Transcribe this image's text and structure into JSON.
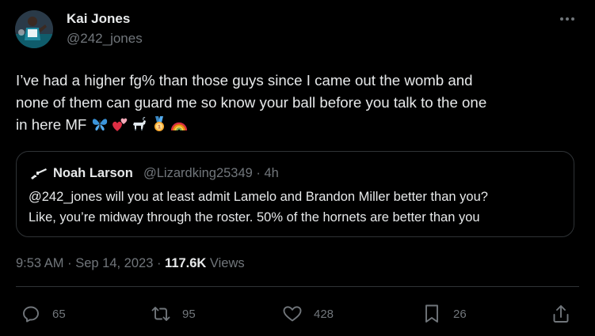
{
  "tweet": {
    "author": {
      "name": "Kai Jones",
      "handle": "@242_jones"
    },
    "text_lines": [
      "I’ve had a higher fg% than those guys since I came out the womb and",
      "none of them can guard me so know your ball before you talk to the one",
      "in here MF"
    ],
    "emojis": [
      "butterfly-icon",
      "two-hearts-icon",
      "goat-icon",
      "medal-icon",
      "rainbow-icon"
    ],
    "quoted": {
      "author_name": "Noah Larson",
      "meta": "@Lizardking25349 · 4h",
      "text_lines": [
        "@242_jones will you at least admit Lamelo and Brandon Miller better than you?",
        "Like, you’re midway through the roster. 50% of the hornets are better than you"
      ]
    },
    "timestamp": "9:53 AM · Sep 14, 2023 · ",
    "views_count": "117.6K",
    "views_label": " Views",
    "actions": {
      "replies": "65",
      "retweets": "95",
      "likes": "428",
      "bookmarks": "26"
    }
  },
  "colors": {
    "background": "#000000",
    "text_primary": "#e7e9ea",
    "text_secondary": "#71767b",
    "border": "#2f3336"
  }
}
